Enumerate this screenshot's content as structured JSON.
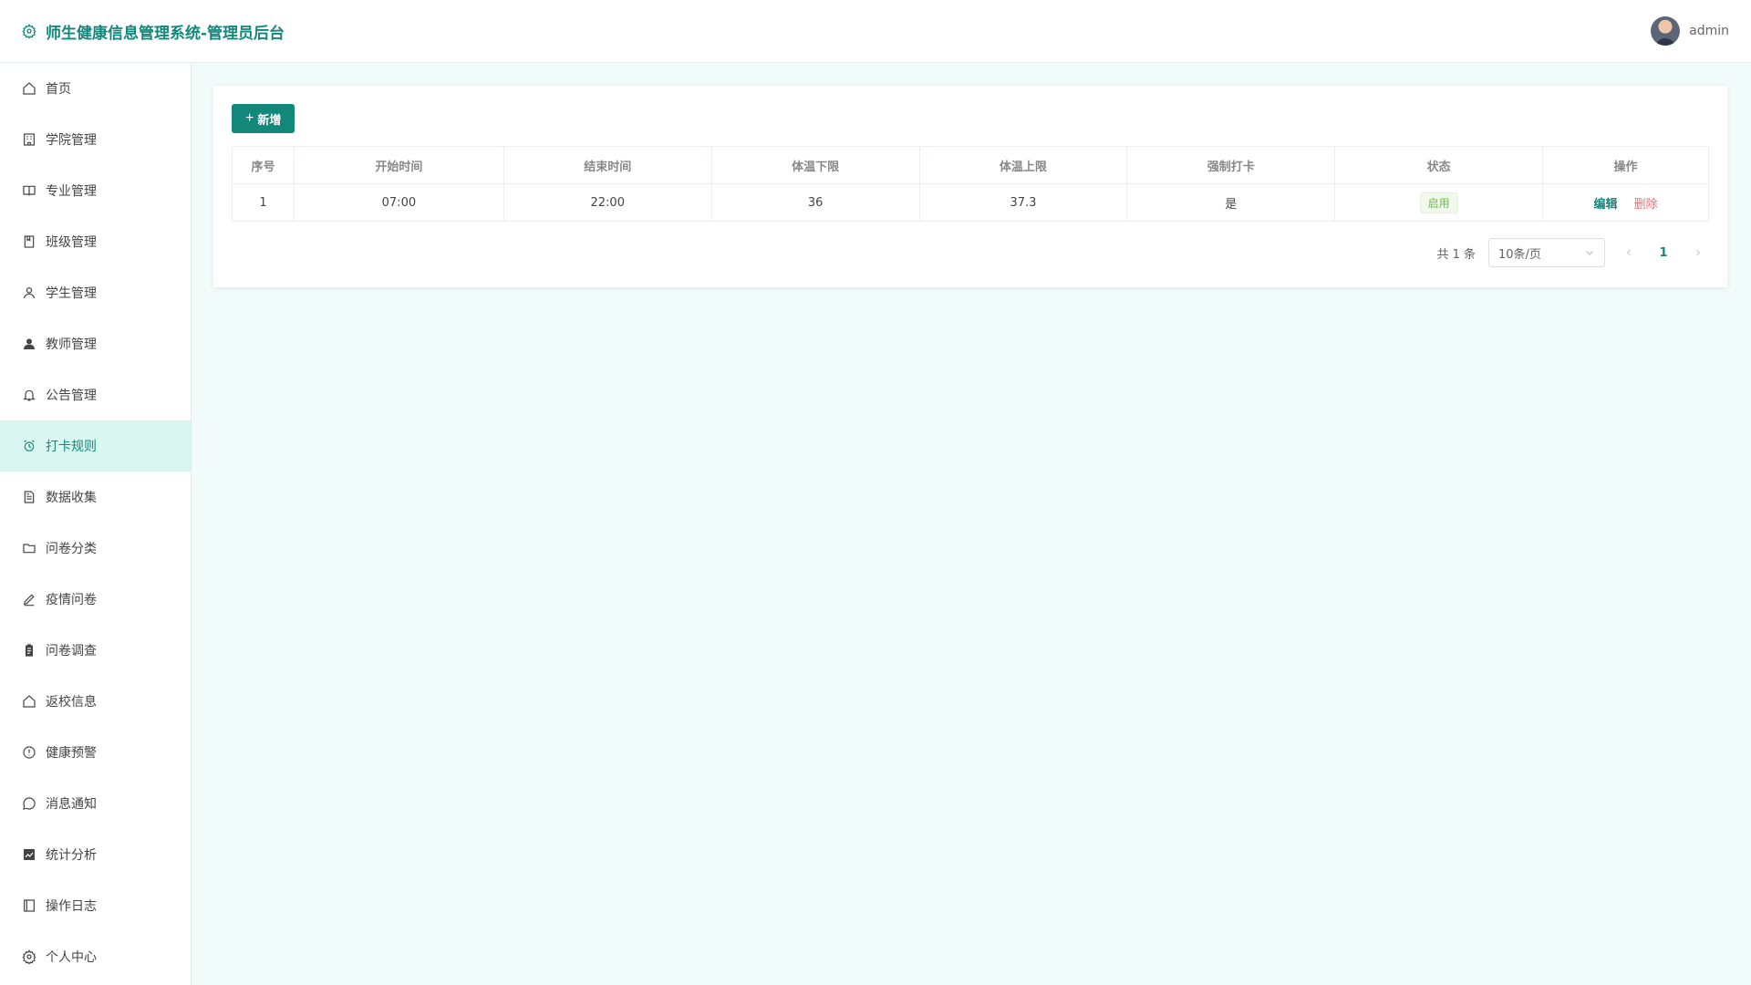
{
  "header": {
    "title": "师生健康信息管理系统-管理员后台",
    "username": "admin"
  },
  "sidebar": {
    "items": [
      {
        "label": "首页",
        "icon": "home-icon"
      },
      {
        "label": "学院管理",
        "icon": "building-icon"
      },
      {
        "label": "专业管理",
        "icon": "book-icon"
      },
      {
        "label": "班级管理",
        "icon": "notebook-icon"
      },
      {
        "label": "学生管理",
        "icon": "user-icon"
      },
      {
        "label": "教师管理",
        "icon": "user-solid-icon"
      },
      {
        "label": "公告管理",
        "icon": "bell-icon"
      },
      {
        "label": "打卡规则",
        "icon": "alarm-clock-icon",
        "active": true
      },
      {
        "label": "数据收集",
        "icon": "document-icon"
      },
      {
        "label": "问卷分类",
        "icon": "folder-icon"
      },
      {
        "label": "疫情问卷",
        "icon": "edit-pen-icon"
      },
      {
        "label": "问卷调查",
        "icon": "clipboard-icon"
      },
      {
        "label": "返校信息",
        "icon": "house-icon"
      },
      {
        "label": "健康预警",
        "icon": "warning-icon"
      },
      {
        "label": "消息通知",
        "icon": "chat-icon"
      },
      {
        "label": "统计分析",
        "icon": "chart-icon"
      },
      {
        "label": "操作日志",
        "icon": "notebook-log-icon"
      },
      {
        "label": "个人中心",
        "icon": "setting-icon"
      }
    ]
  },
  "toolbar": {
    "add_label": "新增"
  },
  "table": {
    "headers": [
      "序号",
      "开始时间",
      "结束时间",
      "体温下限",
      "体温上限",
      "强制打卡",
      "状态",
      "操作"
    ],
    "rows": [
      {
        "index": "1",
        "start": "07:00",
        "end": "22:00",
        "temp_min": "36",
        "temp_max": "37.3",
        "forced": "是",
        "status": "启用",
        "edit": "编辑",
        "delete": "删除"
      }
    ]
  },
  "pagination": {
    "total_text": "共 1 条",
    "page_size": "10条/页",
    "current_page": "1"
  },
  "colors": {
    "accent": "#14877b",
    "active_bg": "#d9f6f0",
    "main_bg": "#f0fbfa",
    "danger": "#f56c6c",
    "success": "#67c23a"
  }
}
